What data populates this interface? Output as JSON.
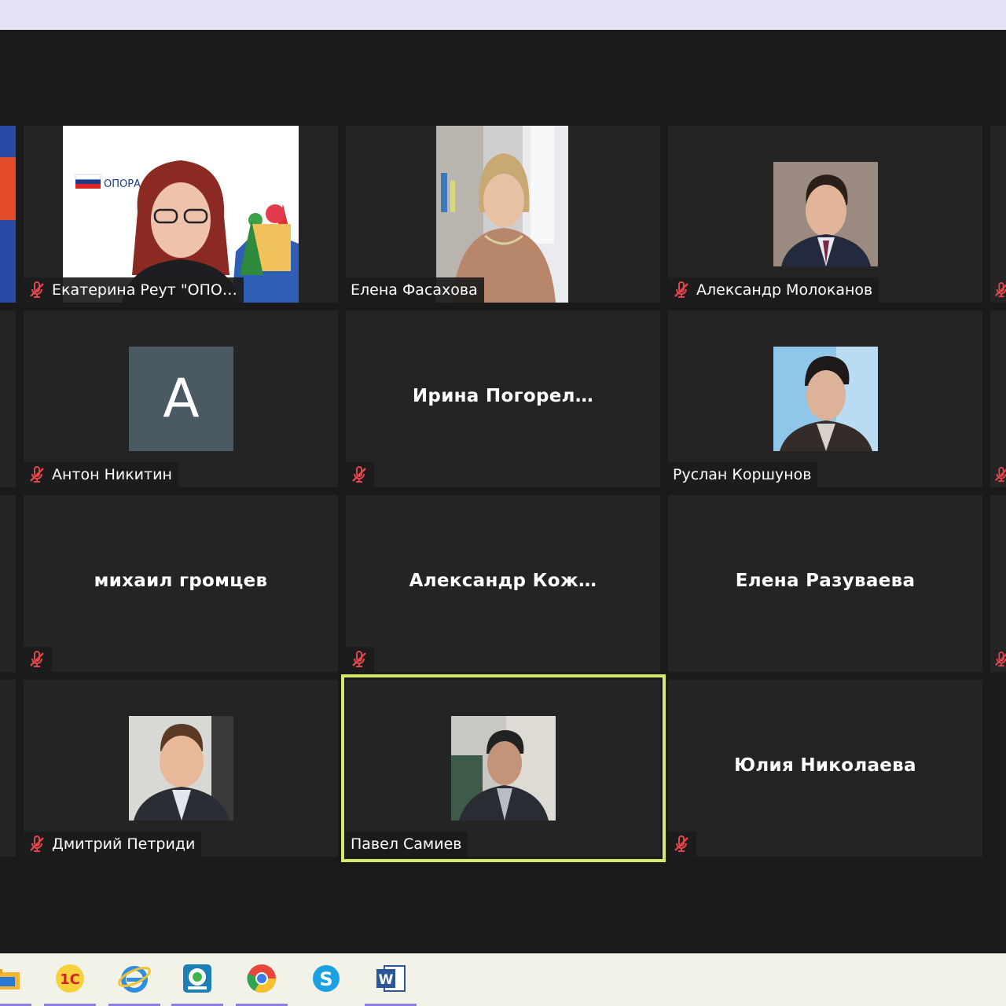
{
  "tiles": [
    {
      "name": "Екатерина Реут \"ОПО…",
      "muted": true
    },
    {
      "name": "Елена Фасахова",
      "muted": false
    },
    {
      "name": "Александр Молоканов",
      "muted": true
    },
    {
      "name": "Антон Никитин",
      "muted": true,
      "avatar_letter": "A"
    },
    {
      "name": "Ирина  Погорел…",
      "muted": true
    },
    {
      "name": "Руслан Коршунов",
      "muted": false
    },
    {
      "name": "михаил громцев",
      "muted": true
    },
    {
      "name": "Александр  Кож…",
      "muted": true
    },
    {
      "name": "Елена Разуваева",
      "muted": false
    },
    {
      "name": "Дмитрий Петриди",
      "muted": true
    },
    {
      "name": "Павел Самиев",
      "muted": false,
      "active_speaker": true
    },
    {
      "name": "Юлия Николаева",
      "muted": true
    }
  ],
  "opora_logo_text": "ОПОРА",
  "colors": {
    "active_speaker_border": "#d4ea6a",
    "mute_icon": "#e0474c",
    "tile_bg": "#242424"
  },
  "taskbar": {
    "apps": [
      {
        "icon": "folder-icon"
      },
      {
        "icon": "1c-icon",
        "text": "1C"
      },
      {
        "icon": "internet-explorer-icon"
      },
      {
        "icon": "messenger-icon"
      },
      {
        "icon": "chrome-icon"
      },
      {
        "icon": "skype-icon",
        "text": "S"
      },
      {
        "icon": "word-icon",
        "text": "W"
      }
    ]
  }
}
